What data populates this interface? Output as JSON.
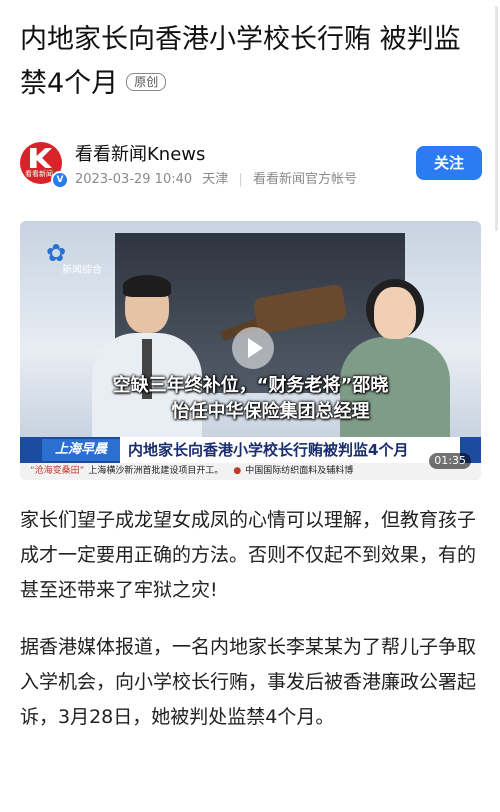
{
  "article": {
    "title": "内地家长向香港小学校长行贿 被判监禁4个月",
    "tag": "原创",
    "paragraphs": [
      "家长们望子成龙望女成凤的心情可以理解，但教育孩子成才一定要用正确的方法。否则不仅起不到效果，有的甚至还带来了牢狱之灾!",
      "据香港媒体报道，一名内地家长李某某为了帮儿子争取入学机会，向小学校长行贿，事发后被香港廉政公署起诉，3月28日，她被判处监禁4个月。"
    ]
  },
  "author": {
    "name": "看看新闻Knews",
    "datetime": "2023-03-29 10:40",
    "location": "天津",
    "account_type": "看看新闻官方帐号",
    "logo_text": "看看新闻",
    "verified_mark": "V",
    "follow_label": "关注"
  },
  "video": {
    "channel_name": "新闻综合",
    "overlay_title_line1": "空缺三年终补位，“财务老将”邵晓",
    "overlay_title_line2": "怡任中华保险集团总经理",
    "program_badge": "上海早晨",
    "headline": "内地家长向香港小学校长行贿被判监4个月",
    "ticker_highlight": "“沧海变桑田”",
    "ticker_text1": "上海横沙新洲首批建设项目开工。",
    "ticker_text2": "中国国际纺织面料及辅料博",
    "duration": "01:35"
  },
  "colors": {
    "accent": "#2b7cf3",
    "brand_red": "#d8232a",
    "news_blue": "#1c4ca0"
  },
  "icons": {
    "play": "play-icon",
    "verified": "verified-icon",
    "channel": "channel-logo-icon"
  }
}
